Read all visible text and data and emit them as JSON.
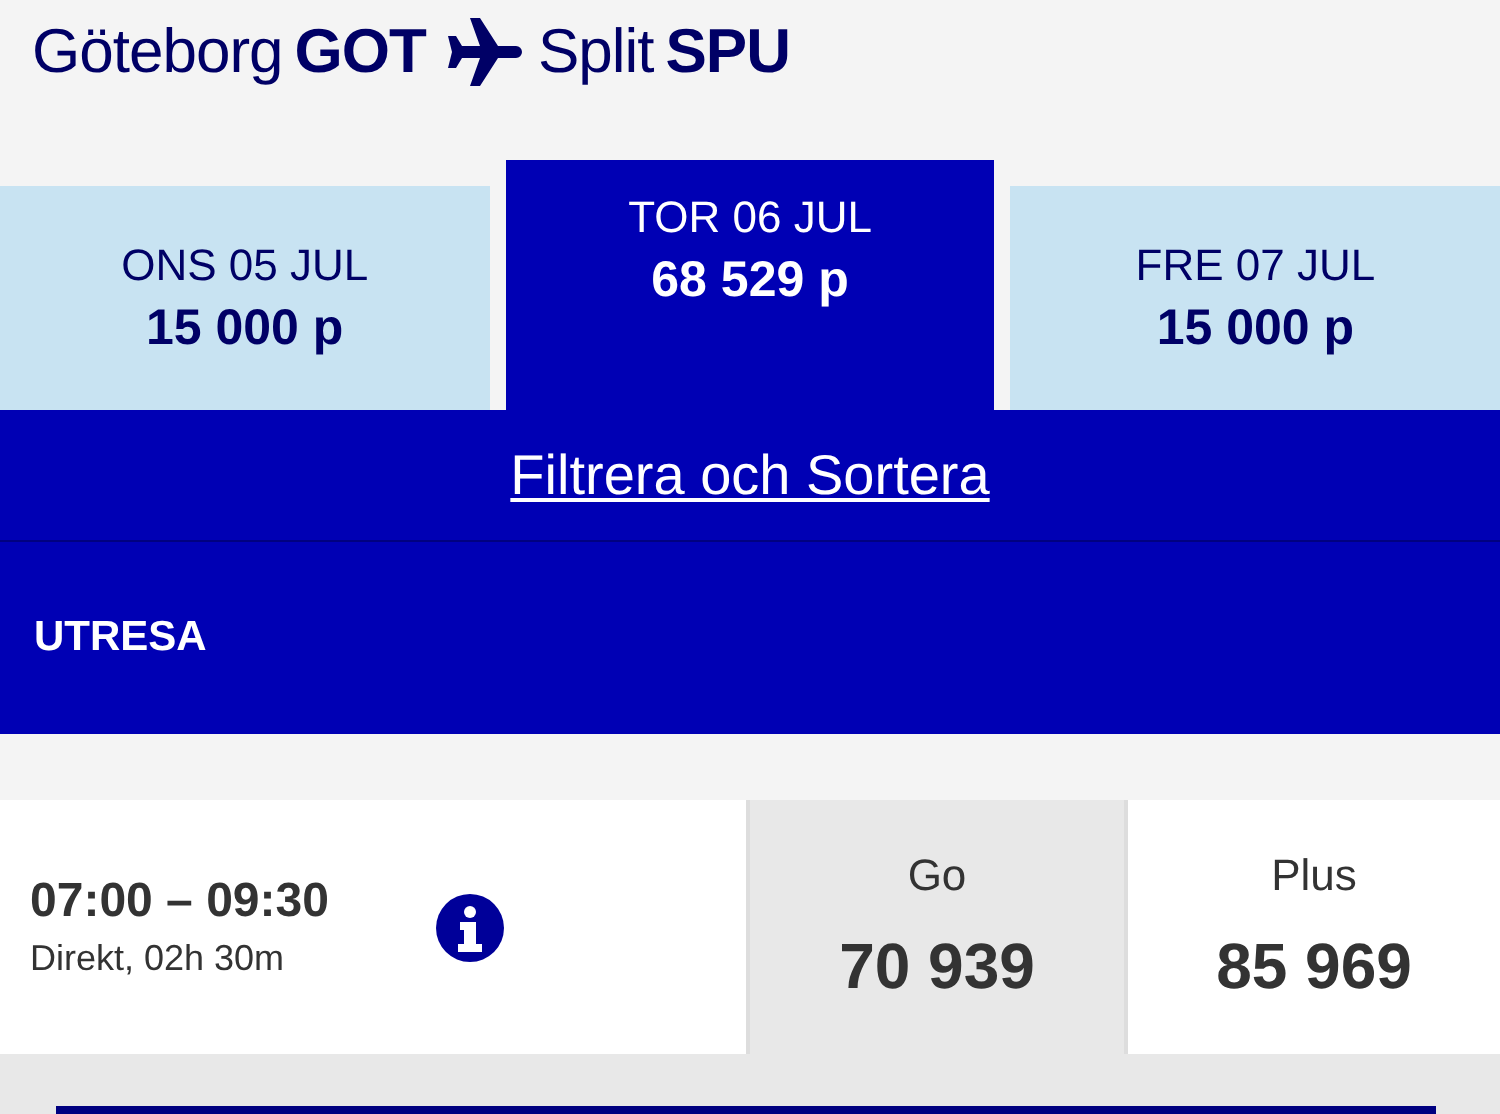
{
  "route": {
    "origin_city": "Göteborg",
    "origin_code": "GOT",
    "destination_city": "Split",
    "destination_code": "SPU"
  },
  "dates": [
    {
      "day": "ONS 05 JUL",
      "price": "15 000 p",
      "selected": false
    },
    {
      "day": "TOR 06 JUL",
      "price": "68 529 p",
      "selected": true
    },
    {
      "day": "FRE 07 JUL",
      "price": "15 000 p",
      "selected": false
    }
  ],
  "filter_link": "Filtrera och Sortera",
  "section_title": "UTRESA",
  "flights": [
    {
      "time": "07:00 – 09:30",
      "details": "Direkt, 02h 30m",
      "fares": [
        {
          "name": "Go",
          "price": "70 939",
          "selected": true
        },
        {
          "name": "Plus",
          "price": "85 969",
          "selected": false
        }
      ]
    }
  ]
}
